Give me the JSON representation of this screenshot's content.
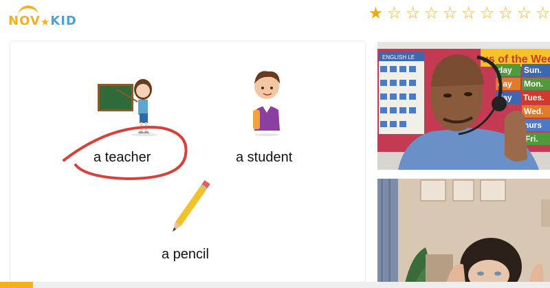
{
  "brand": {
    "logo_left": "NOV",
    "logo_right": "KID",
    "color_primary": "#f6b01a",
    "color_secondary": "#4aa3d8"
  },
  "stars": {
    "total": 10,
    "filled": 1,
    "icon": "star-icon"
  },
  "lesson": {
    "items": [
      {
        "label": "a teacher",
        "icon": "teacher-icon",
        "circled": true
      },
      {
        "label": "a student",
        "icon": "student-icon",
        "circled": false
      },
      {
        "label": "a pencil",
        "icon": "pencil-icon",
        "circled": false
      }
    ],
    "annotation_color": "#d9403a"
  },
  "video": {
    "teacher_poster": {
      "title_partial": "us of the Week",
      "days": [
        "day",
        "Sun.",
        "day",
        "Mon.",
        "day",
        "Tues.",
        "Wed.",
        "hurs",
        "Fri."
      ],
      "banner": "ENGLISH LE"
    }
  },
  "progress": {
    "fraction": 0.06
  }
}
